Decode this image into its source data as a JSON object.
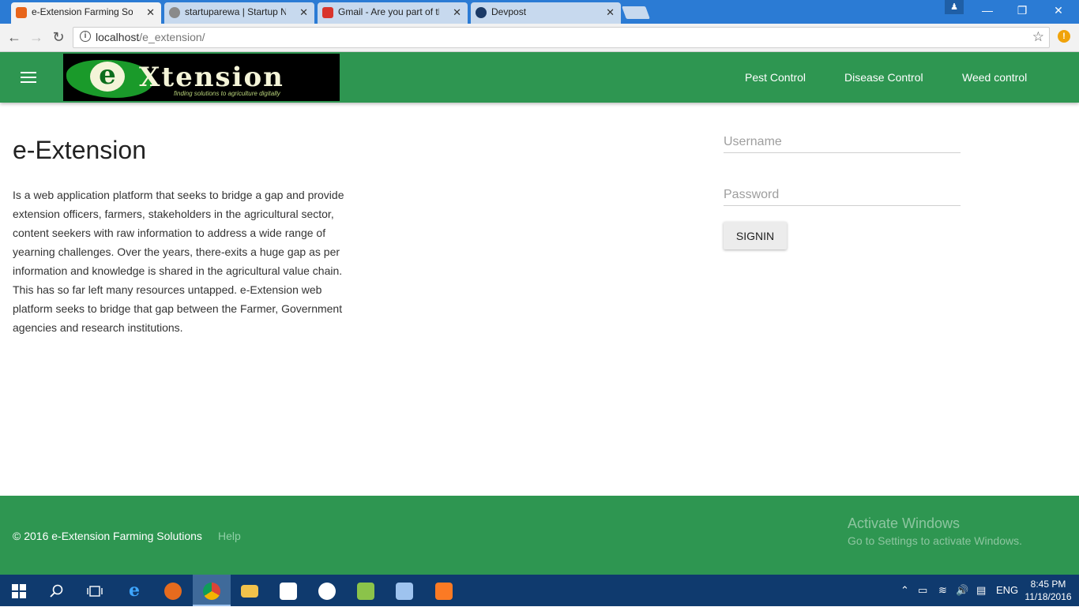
{
  "browser": {
    "tabs": [
      {
        "title": "e-Extension Farming Solu",
        "favicon_color": "#e8651a",
        "active": true
      },
      {
        "title": "startuparewa | Startup N",
        "favicon_color": "#8a8a8a",
        "active": false
      },
      {
        "title": "Gmail - Are you part of th",
        "favicon_color": "#d9342b",
        "active": false
      },
      {
        "title": "Devpost",
        "favicon_color": "#1b3a66",
        "active": false
      }
    ],
    "close_glyph": "✕",
    "url_host": "localhost",
    "url_path": "/e_extension/",
    "window_controls": {
      "minimize": "—",
      "restore": "❐",
      "close": "✕"
    }
  },
  "header": {
    "logo": {
      "letter": "e",
      "word": "Xtension",
      "tagline": "finding solutions to agriculture digitally"
    },
    "nav": [
      "Pest Control",
      "Disease Control",
      "Weed control"
    ]
  },
  "main": {
    "title": "e-Extension",
    "description": "Is a web application platform that seeks to bridge a gap and provide extension officers, farmers, stakeholders in the agricultural sector, content seekers with raw information to address a wide range of yearning challenges. Over the years, there-exits a huge gap as per information and knowledge is shared in the agricultural value chain. This has so far left many resources untapped. e-Extension web platform seeks to bridge that gap between the Farmer, Government agencies and research institutions."
  },
  "login": {
    "username_placeholder": "Username",
    "password_placeholder": "Password",
    "signin_label": "SIGNIN"
  },
  "footer": {
    "copyright": "© 2016 e-Extension Farming Solutions",
    "help": "Help",
    "activate_title": "Activate Windows",
    "activate_sub": "Go to Settings to activate Windows."
  },
  "taskbar": {
    "language": "ENG",
    "time": "8:45 PM",
    "date": "11/18/2016"
  },
  "colors": {
    "brand_green": "#2e9651",
    "chrome_blue": "#2b7bd4",
    "taskbar": "#0f3a6e"
  }
}
